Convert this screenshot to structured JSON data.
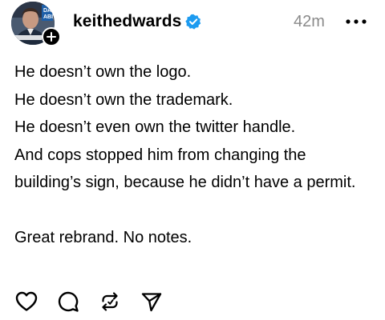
{
  "post": {
    "author": {
      "username": "keithedwards",
      "verified": true,
      "avatar_badge_text_top": "DA",
      "avatar_badge_text_bottom": "ABI"
    },
    "timestamp": "42m",
    "more_icon": "more-horizontal-icon",
    "lines": [
      "He doesn’t own the logo.",
      "He doesn’t own the trademark.",
      "He doesn’t even own the twitter handle.",
      "And cops stopped him from changing the building’s sign, because he didn’t have a permit."
    ],
    "closing_line": "Great rebrand. No notes."
  },
  "actions": {
    "like_icon": "heart-icon",
    "reply_icon": "comment-icon",
    "repost_icon": "repost-icon",
    "share_icon": "send-icon"
  },
  "colors": {
    "text": "#000000",
    "muted": "#8a8a8a",
    "verified_badge": "#1d9bf0",
    "background": "#ffffff"
  }
}
